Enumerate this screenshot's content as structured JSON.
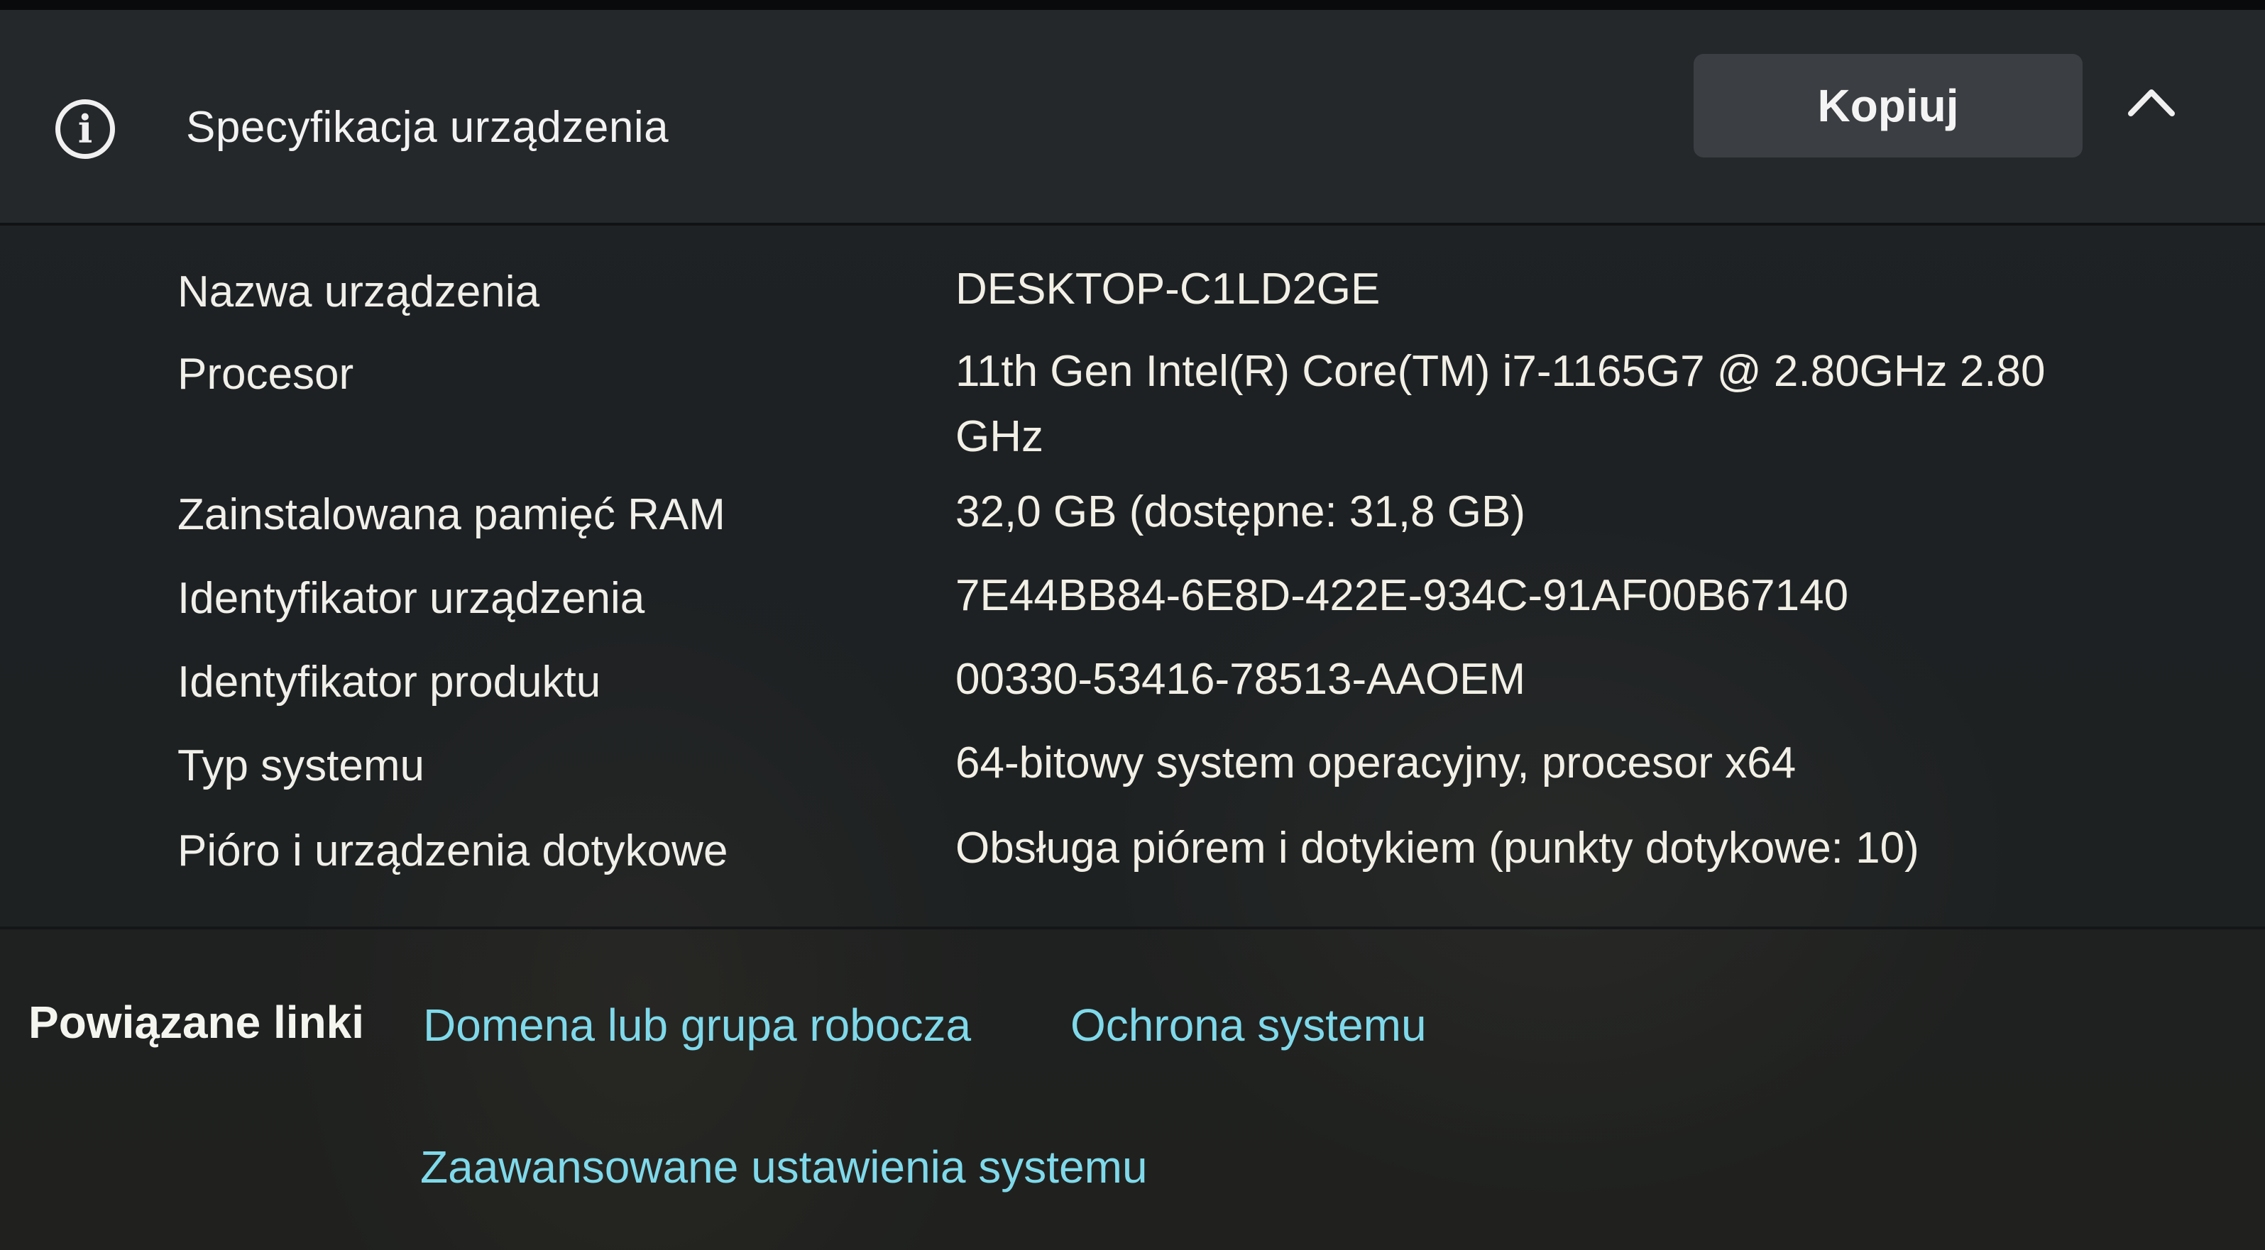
{
  "header": {
    "title": "Specyfikacja urządzenia",
    "copy_label": "Kopiuj",
    "info_icon": "info-icon",
    "collapse_icon": "chevron-up-icon"
  },
  "specs": [
    {
      "label": "Nazwa urządzenia",
      "value": "DESKTOP-C1LD2GE"
    },
    {
      "label": "Procesor",
      "value": "11th Gen Intel(R) Core(TM) i7-1165G7 @ 2.80GHz   2.80 GHz"
    },
    {
      "label": "Zainstalowana pamięć RAM",
      "value": "32,0 GB (dostępne: 31,8 GB)"
    },
    {
      "label": "Identyfikator urządzenia",
      "value": "7E44BB84-6E8D-422E-934C-91AF00B67140"
    },
    {
      "label": "Identyfikator produktu",
      "value": "00330-53416-78513-AAOEM"
    },
    {
      "label": "Typ systemu",
      "value": "64-bitowy system operacyjny, procesor x64"
    },
    {
      "label": "Pióro i urządzenia dotykowe",
      "value": "Obsługa piórem i dotykiem (punkty dotykowe: 10)"
    }
  ],
  "related": {
    "label": "Powiązane linki",
    "links": [
      "Domena lub grupa robocza",
      "Ochrona systemu",
      "Zaawansowane ustawienia systemu"
    ]
  },
  "colors": {
    "link": "#7fd9ea",
    "text": "#f2f0e6",
    "button_bg": "#3b3e42"
  }
}
